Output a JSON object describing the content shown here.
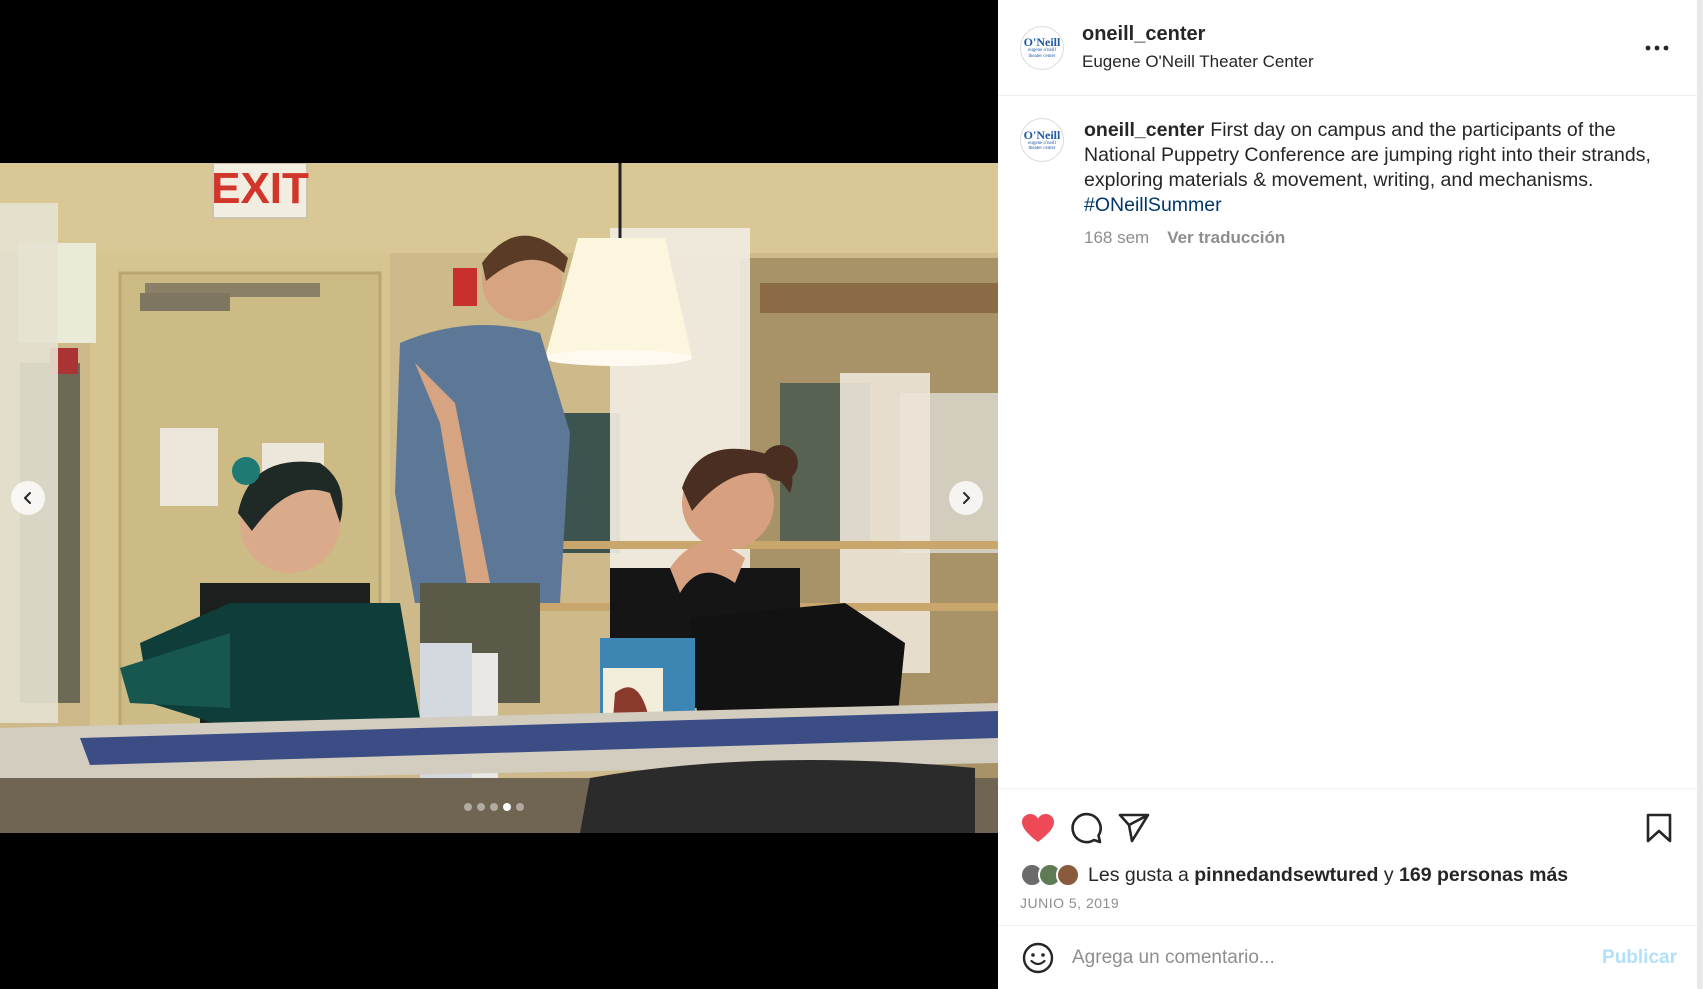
{
  "post": {
    "username": "oneill_center",
    "location": "Eugene O'Neill Theater Center",
    "avatar_logo_main": "O'Neill",
    "avatar_logo_sub": "eugene o'neill theater center",
    "more_icon": "more-horizontal-icon"
  },
  "media": {
    "image_alt": "Photo of three puppetry participants at a table with bags and books",
    "exit_sign": "EXIT",
    "carousel_dots": 5,
    "carousel_active_index": 3,
    "prev_icon": "chevron-left-icon",
    "next_icon": "chevron-right-icon"
  },
  "caption": {
    "username": "oneill_center",
    "text": "First day on campus and the participants of the National Puppetry Conference are jumping right into their strands, exploring materials & movement, writing, and mechanisms.",
    "hashtag": "#ONeillSummer",
    "time": "168 sem",
    "translate": "Ver traducción"
  },
  "actions": {
    "liked": true,
    "like_color": "#ed4956",
    "like_icon": "heart-icon",
    "comment_icon": "comment-icon",
    "share_icon": "send-icon",
    "save_icon": "bookmark-icon"
  },
  "likes": {
    "prefix": "Les gusta a",
    "user": "pinnedandsewtured",
    "conjunction": "y",
    "others": "169 personas más"
  },
  "date": "JUNIO 5, 2019",
  "comment": {
    "placeholder": "Agrega un comentario...",
    "publish": "Publicar",
    "emoji_icon": "smiley-icon"
  },
  "colors": {
    "hashtag": "#00376b",
    "publish_disabled": "#b2dffc",
    "muted": "#8e8e8e"
  }
}
